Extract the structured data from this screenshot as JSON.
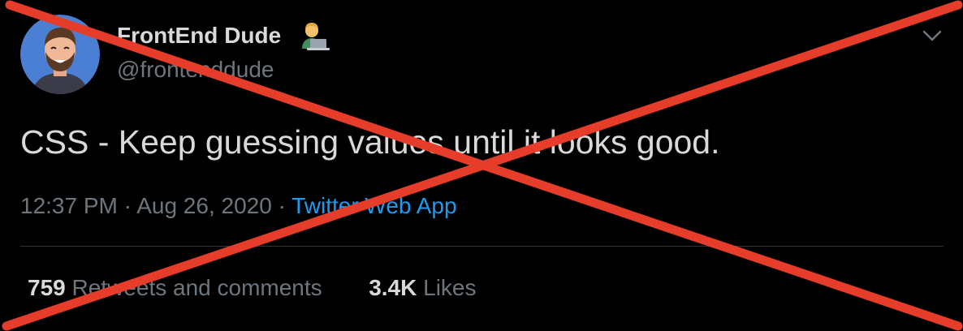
{
  "tweet": {
    "display_name": "FrontEnd Dude",
    "name_emoji_icon": "technologist-emoji-icon",
    "handle": "@frontenddude",
    "text": "CSS - Keep guessing values until it looks good.",
    "time": "12:37 PM",
    "separator": "·",
    "date": "Aug 26, 2020",
    "source": "Twitter Web App",
    "retweets_count": "759",
    "retweets_label": "Retweets and comments",
    "likes_count": "3.4K",
    "likes_label": "Likes"
  },
  "icons": {
    "menu": "chevron-down-icon",
    "avatar": "avatar-cartoon"
  },
  "colors": {
    "background": "#000000",
    "primary_text": "#d9d9d9",
    "secondary_text": "#6e767d",
    "link": "#1d9bf0",
    "divider": "#2f3336",
    "avatar_bg": "#4a7fd4",
    "cross_out": "#e63c2a"
  }
}
